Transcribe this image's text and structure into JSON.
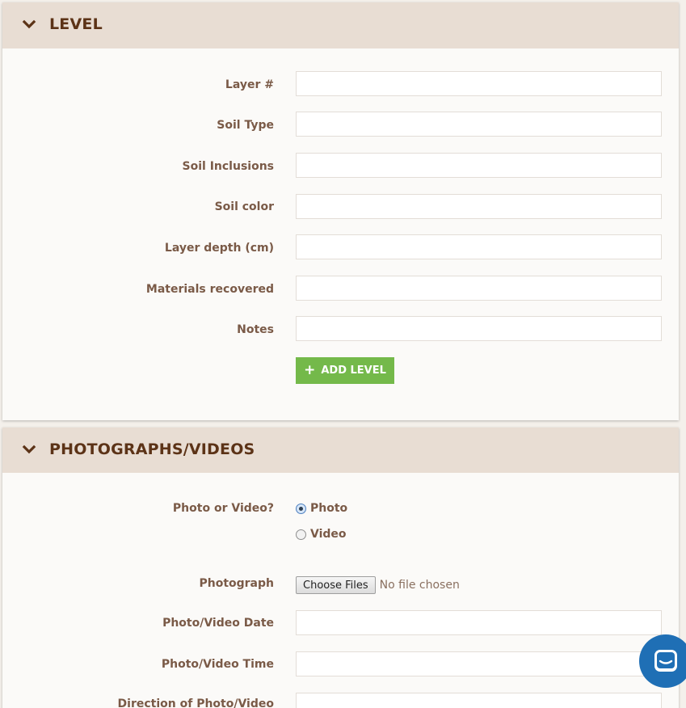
{
  "colors": {
    "header_bg": "#e8ddd3",
    "title_text": "#5c3317",
    "label_text": "#7a5a47",
    "add_button": "#74b94a",
    "chat_bubble": "#1f6fb5"
  },
  "level_panel": {
    "title": "LEVEL",
    "toggle_icon": "chevron-down-icon",
    "fields": [
      {
        "label": "Layer #",
        "value": ""
      },
      {
        "label": "Soil Type",
        "value": ""
      },
      {
        "label": "Soil Inclusions",
        "value": ""
      },
      {
        "label": "Soil color",
        "value": ""
      },
      {
        "label": "Layer depth (cm)",
        "value": ""
      },
      {
        "label": "Materials recovered",
        "value": ""
      },
      {
        "label": "Notes",
        "value": ""
      }
    ],
    "add_button": {
      "icon": "plus-icon",
      "label": "ADD LEVEL"
    }
  },
  "photos_panel": {
    "title": "PHOTOGRAPHS/VIDEOS",
    "toggle_icon": "chevron-down-icon",
    "media_type": {
      "label": "Photo or Video?",
      "options": [
        {
          "label": "Photo",
          "selected": true
        },
        {
          "label": "Video",
          "selected": false
        }
      ]
    },
    "photograph": {
      "label": "Photograph",
      "button_label": "Choose Files",
      "status": "No file chosen"
    },
    "fields": [
      {
        "label": "Photo/Video Date",
        "value": ""
      },
      {
        "label": "Photo/Video Time",
        "value": ""
      },
      {
        "label": "Direction of Photo/Video",
        "value": ""
      }
    ]
  },
  "chat_widget": {
    "icon": "chat-icon"
  }
}
